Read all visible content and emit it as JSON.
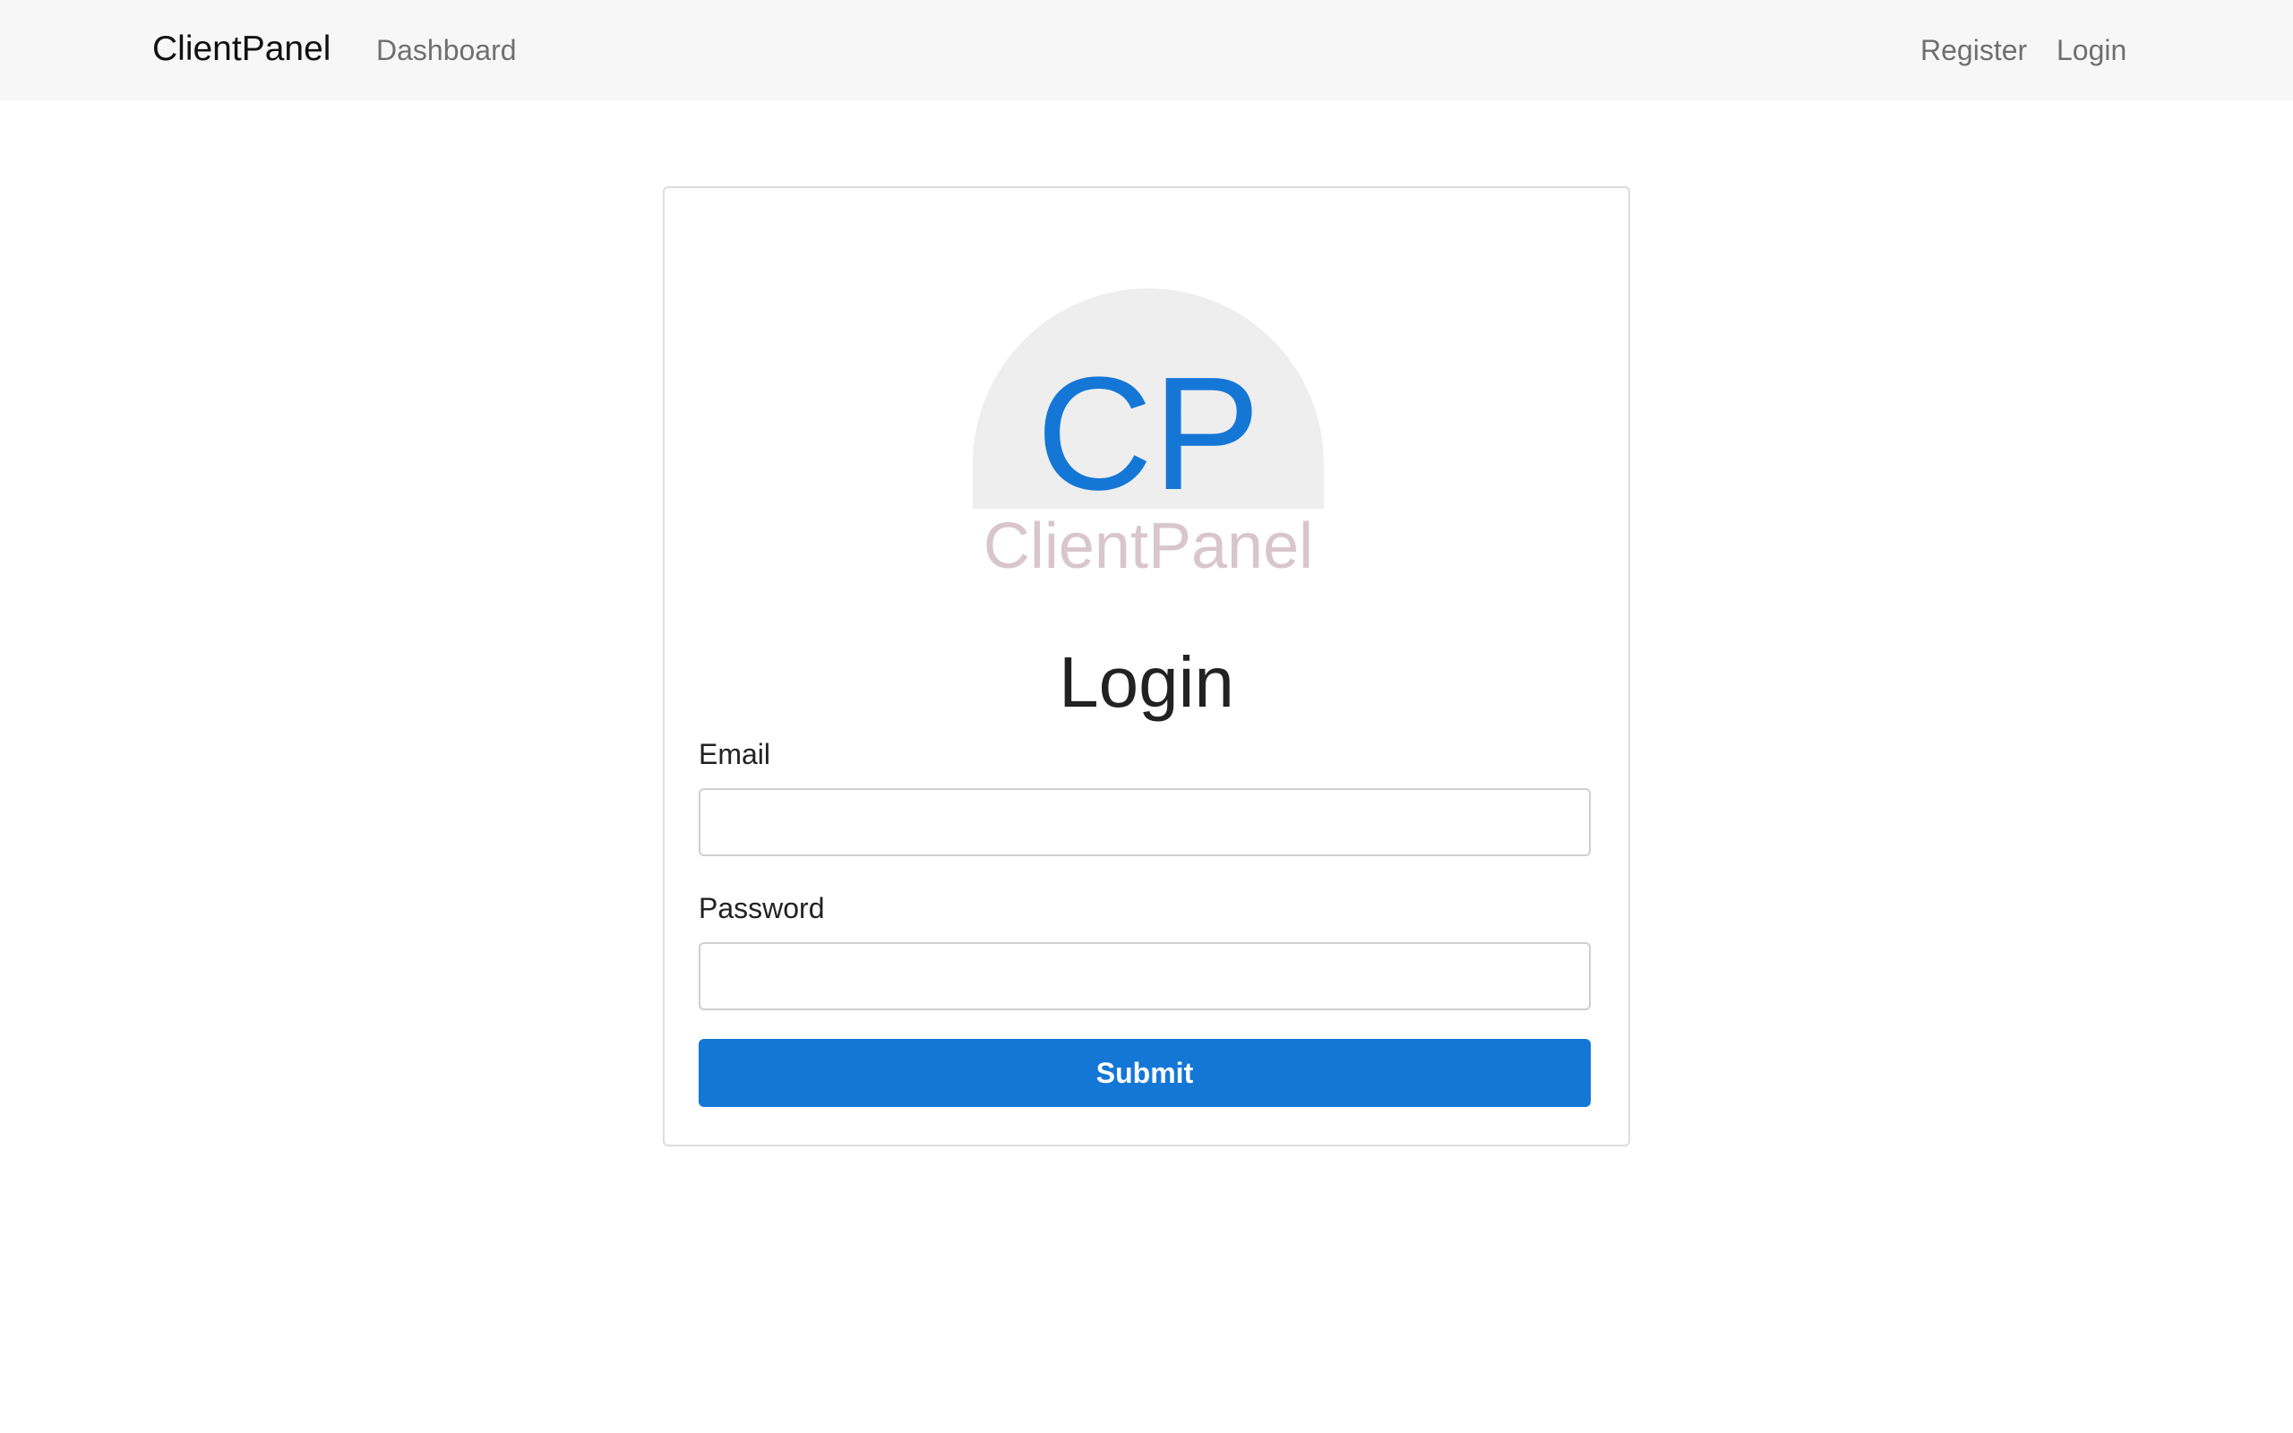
{
  "navbar": {
    "brand": "ClientPanel",
    "links_left": [
      {
        "label": "Dashboard"
      }
    ],
    "links_right": [
      {
        "label": "Register"
      },
      {
        "label": "Login"
      }
    ]
  },
  "logo": {
    "monogram": "CP",
    "wordmark": "ClientPanel",
    "colors": {
      "monogram": "#1477d6",
      "wordmark": "#d8c6cc",
      "circle": "#eeeeee"
    }
  },
  "form": {
    "title": "Login",
    "fields": [
      {
        "label": "Email",
        "value": "",
        "placeholder": ""
      },
      {
        "label": "Password",
        "value": "",
        "placeholder": ""
      }
    ],
    "submit_label": "Submit"
  },
  "colors": {
    "navbar_bg": "#f7f7f7",
    "primary": "#1477d6",
    "card_border": "#dcdcdc"
  }
}
